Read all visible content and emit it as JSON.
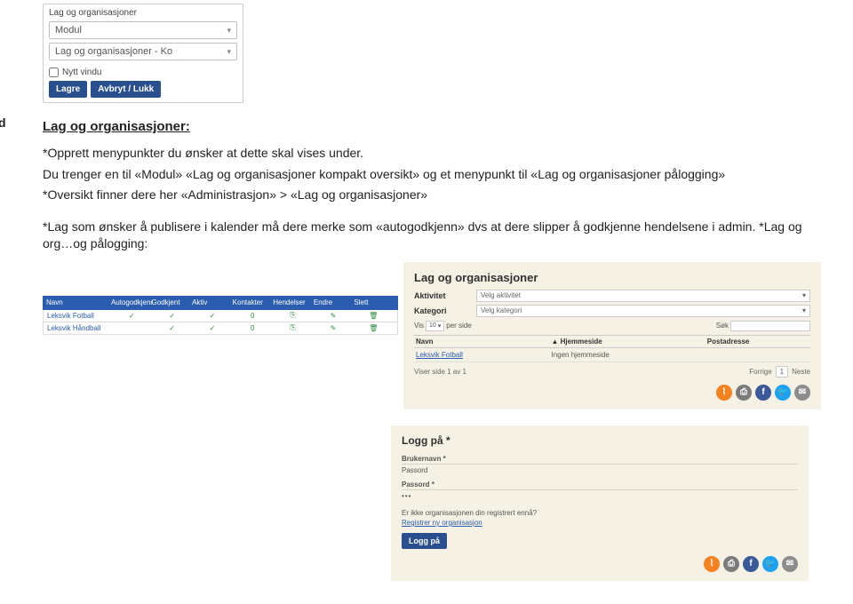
{
  "edge_letter": "d",
  "form_box": {
    "label1": "Lag og organisasjoner",
    "select1_value": "Modul",
    "select2_value": "Lag og organisasjoner - Ko",
    "checkbox_label": "Nytt vindu",
    "btn_save": "Lagre",
    "btn_cancel": "Avbryt / Lukk"
  },
  "doc": {
    "heading": "Lag og organisasjoner:",
    "line1": "*Opprett menypunkter du ønsker at dette skal vises under.",
    "line2": "Du trenger en til «Modul» «Lag og organisasjoner kompakt oversikt» og et menypunkt til «Lag og organisasjoner pålogging»",
    "line3": "*Oversikt finner dere her «Administrasjon» > «Lag og organisasjoner»",
    "line4": "*Lag som ønsker å publisere i kalender må dere merke som «autogodkjenn» dvs at dere slipper å godkjenne hendelsene i admin. *Lag og org…og pålogging:"
  },
  "lefttbl": {
    "cols": [
      "Navn",
      "Autogodkjenning",
      "Godkjent",
      "Aktiv",
      "Kontakter",
      "Hendelser",
      "Endre",
      "Slett"
    ],
    "rows": [
      {
        "navn": "Leksvik Fotball",
        "c2": "✓",
        "c3": "✓",
        "c4": "✓",
        "c5": "0",
        "c6": "⎘",
        "c7": "✎",
        "c8": "🗑"
      },
      {
        "navn": "Leksvik Håndball",
        "c2": "",
        "c3": "✓",
        "c4": "✓",
        "c5": "0",
        "c6": "⎘",
        "c7": "✎",
        "c8": "🗑"
      }
    ]
  },
  "rightpanel": {
    "title": "Lag og organisasjoner",
    "label_activity": "Aktivitet",
    "sel_activity": "Velg aktivitet",
    "label_category": "Kategori",
    "sel_category": "Velg kategori",
    "vis_prefix": "Vis",
    "vis_count": "10",
    "vis_suffix": "per side",
    "sok_label": "Søk",
    "col_navn": "Navn",
    "col_hjemmeside": "Hjemmeside",
    "col_post": "Postadresse",
    "row_navn": "Leksvik Fotball",
    "row_hjemmeside": "Ingen hjemmeside",
    "footer_left": "Viser side 1 av 1",
    "pager_prev": "Forrige",
    "pager_page": "1",
    "pager_next": "Neste",
    "rss_glyph": "⌇",
    "print_glyph": "⎙",
    "fb_glyph": "f",
    "tw_glyph": "🐦",
    "mail_glyph": "✉"
  },
  "login": {
    "title": "Logg på *",
    "label_user": "Brukernavn *",
    "val_user": "Passord",
    "label_pass": "Passord *",
    "val_pass": "•••",
    "note": "Er ikke organisasjonen din registrert ennå?",
    "reglink": "Registrer ny organisasjon",
    "btn": "Logg på"
  }
}
